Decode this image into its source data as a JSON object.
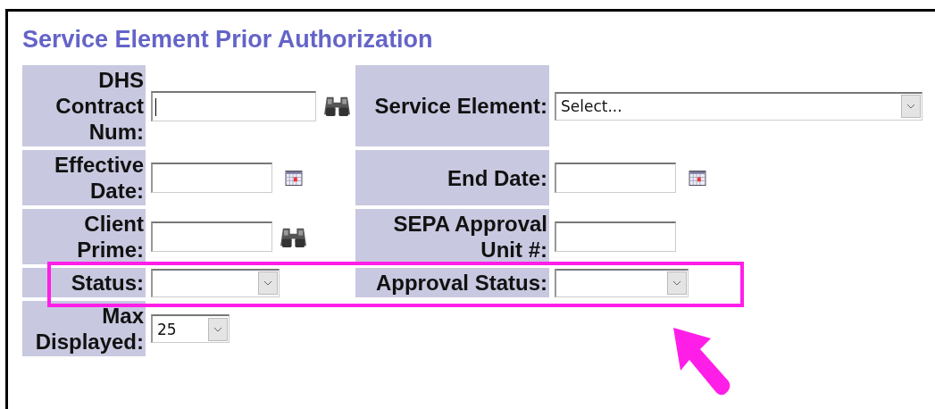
{
  "title": "Service Element Prior Authorization",
  "rows": [
    {
      "cells": [
        {
          "label": "DHS Contract Num:",
          "kind": "lookup",
          "control": {
            "kind": "text",
            "focused": true
          }
        },
        {
          "label": "Service Element:",
          "kind": "plain",
          "control": {
            "kind": "select",
            "value": "Select..."
          }
        }
      ]
    },
    {
      "cells": [
        {
          "label": "Effective Date:",
          "kind": "calendar",
          "control": {
            "kind": "text"
          }
        },
        {
          "label": "End Date:",
          "kind": "calendar",
          "control": {
            "kind": "text"
          }
        }
      ]
    },
    {
      "cells": [
        {
          "label": "Client Prime:",
          "kind": "lookup",
          "control": {
            "kind": "text"
          }
        },
        {
          "label": "SEPA Approval Unit #:",
          "kind": "plain",
          "control": {
            "kind": "text"
          }
        }
      ]
    },
    {
      "cells": [
        {
          "label": "Status:",
          "kind": "plain",
          "control": {
            "kind": "select"
          }
        },
        {
          "label": "Approval Status:",
          "kind": "plain",
          "control": {
            "kind": "select"
          }
        }
      ]
    },
    {
      "cells": [
        {
          "label": "Max Displayed:",
          "kind": "plain",
          "control": {
            "kind": "select",
            "value": "25"
          }
        }
      ]
    }
  ]
}
